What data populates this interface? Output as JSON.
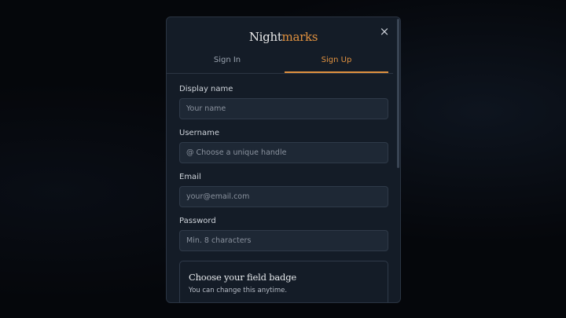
{
  "brand": {
    "part1": "Night",
    "part2": "marks"
  },
  "close_icon": "×",
  "tabs": [
    {
      "label": "Sign In",
      "active": false
    },
    {
      "label": "Sign Up",
      "active": true
    }
  ],
  "form": {
    "display_name": {
      "label": "Display name",
      "placeholder": "Your name"
    },
    "username": {
      "label": "Username",
      "placeholder": "@ Choose a unique handle"
    },
    "email": {
      "label": "Email",
      "placeholder": "your@email.com"
    },
    "password": {
      "label": "Password",
      "placeholder": "Min. 8 characters"
    }
  },
  "badge": {
    "title": "Choose your field badge",
    "subtitle": "You can change this anytime."
  },
  "colors": {
    "accent": "#e0913f",
    "modal_bg": "#141c27",
    "input_bg": "#1e2835"
  }
}
